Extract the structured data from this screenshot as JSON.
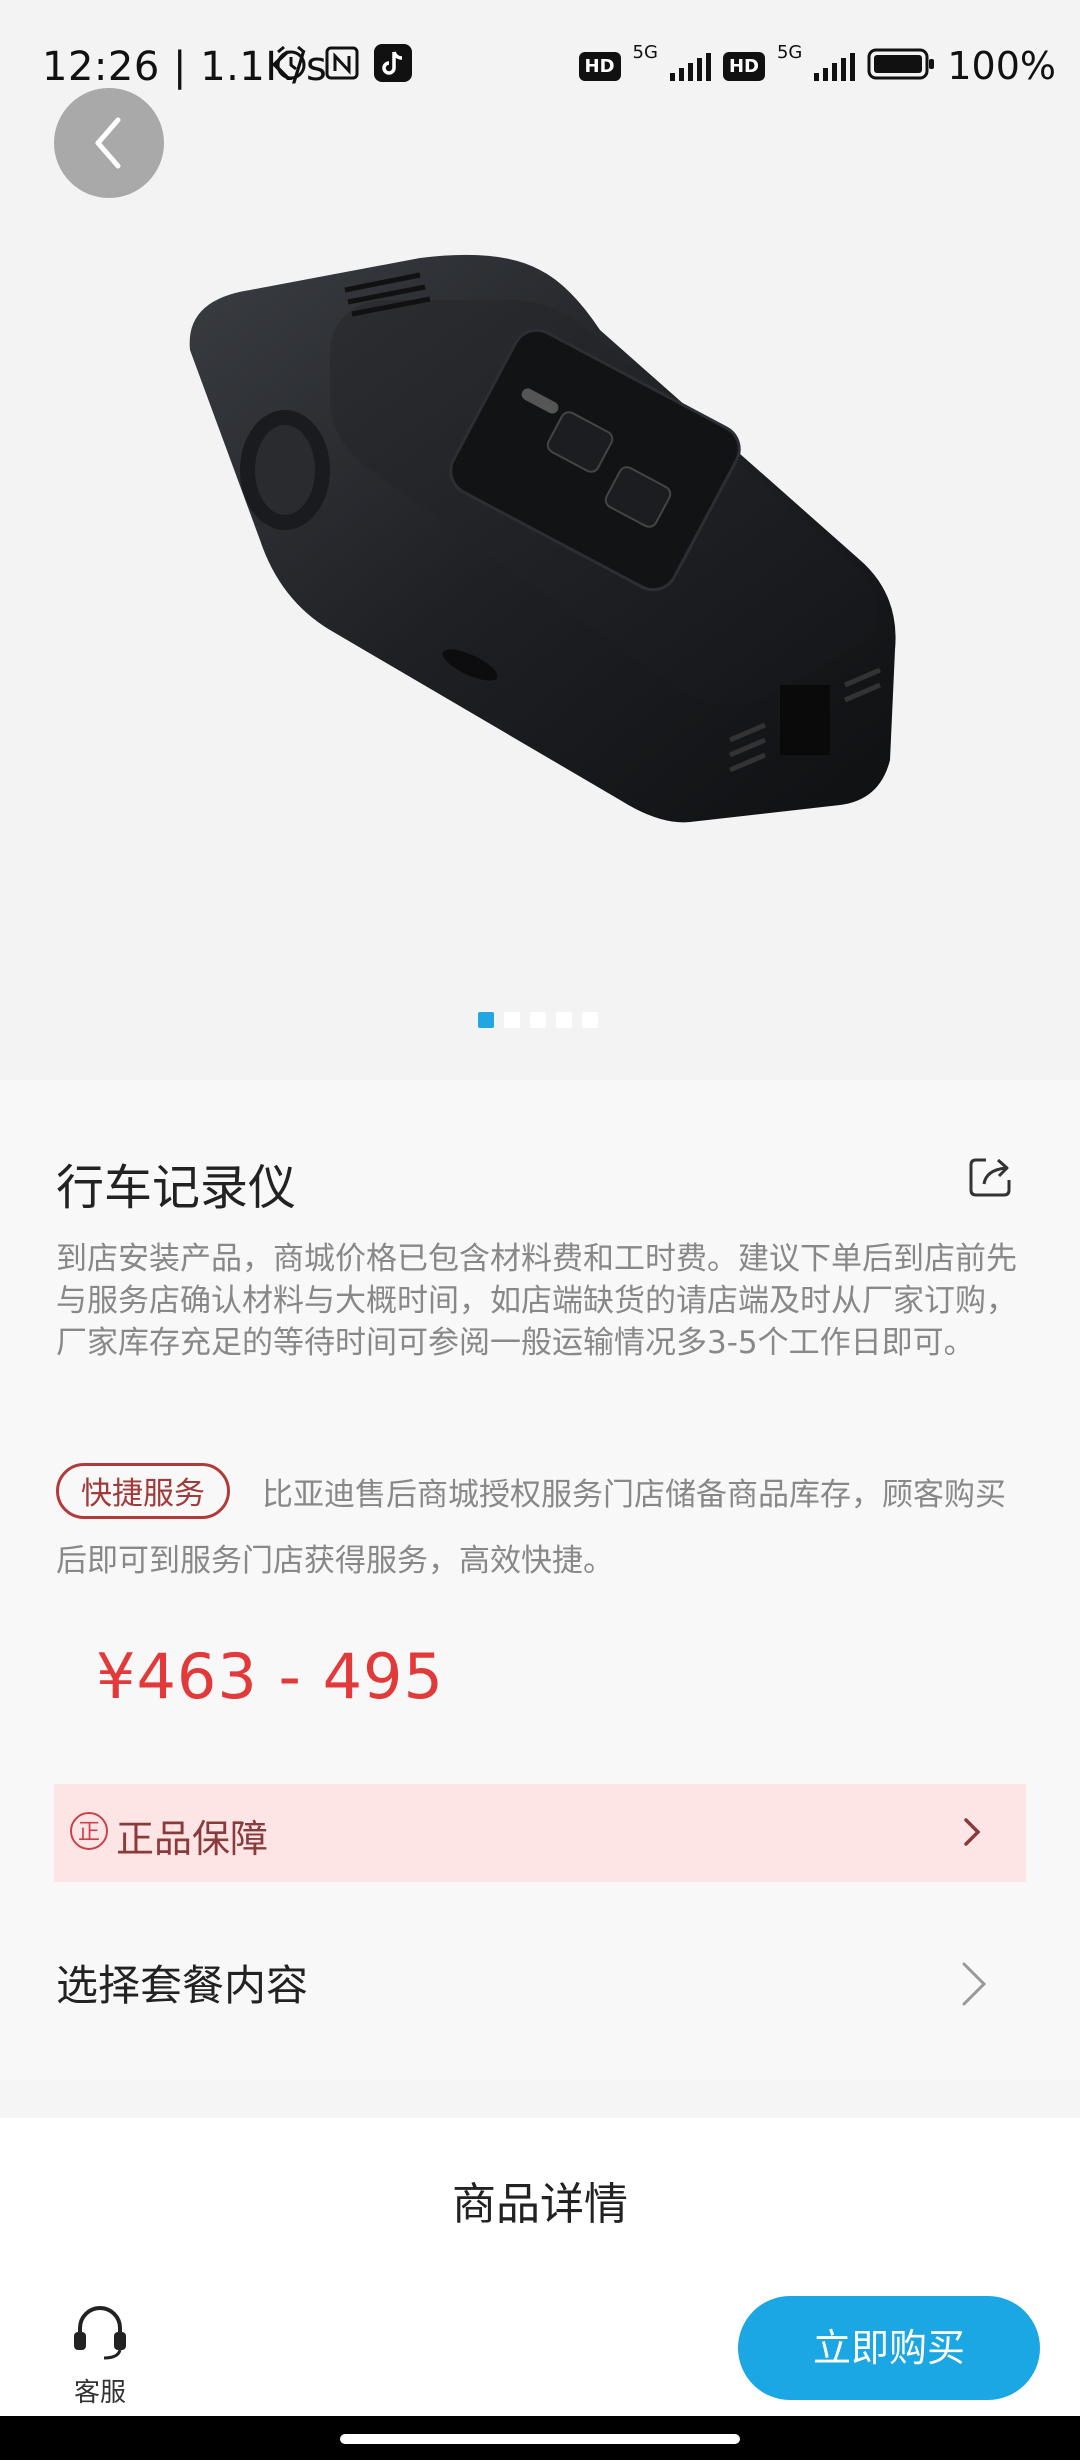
{
  "status_bar": {
    "time": "12:26",
    "net_speed": "1.1K/s",
    "hd1": "HD",
    "fiveg1": "5G",
    "hd2": "HD",
    "fiveg2": "5G",
    "battery": "100%"
  },
  "product": {
    "title": "行车记录仪",
    "description": "到店安装产品，商城价格已包含材料费和工时费。建议下单后到店前先与服务店确认材料与大概时间，如店端缺货的请店端及时从厂家订购，厂家库存充足的等待时间可参阅一般运输情况多3-5个工作日即可。",
    "service_tag": "快捷服务",
    "service_text": "比亚迪售后商城授权服务门店储备商品库存，顾客购买后即可到服务门店获得服务，高效快捷。",
    "price": "¥463 - 495"
  },
  "guarantee": {
    "icon_text": "正",
    "label": "正品保障"
  },
  "package": {
    "label": "选择套餐内容"
  },
  "details": {
    "title": "商品详情"
  },
  "bottom_bar": {
    "customer_service_label": "客服",
    "buy_label": "立即购买"
  },
  "carousel": {
    "count": 5,
    "active_index": 0
  },
  "colors": {
    "accent_blue": "#1aa7e3",
    "price_red": "#e23a3a",
    "guarantee_bg": "#fde5e6"
  }
}
